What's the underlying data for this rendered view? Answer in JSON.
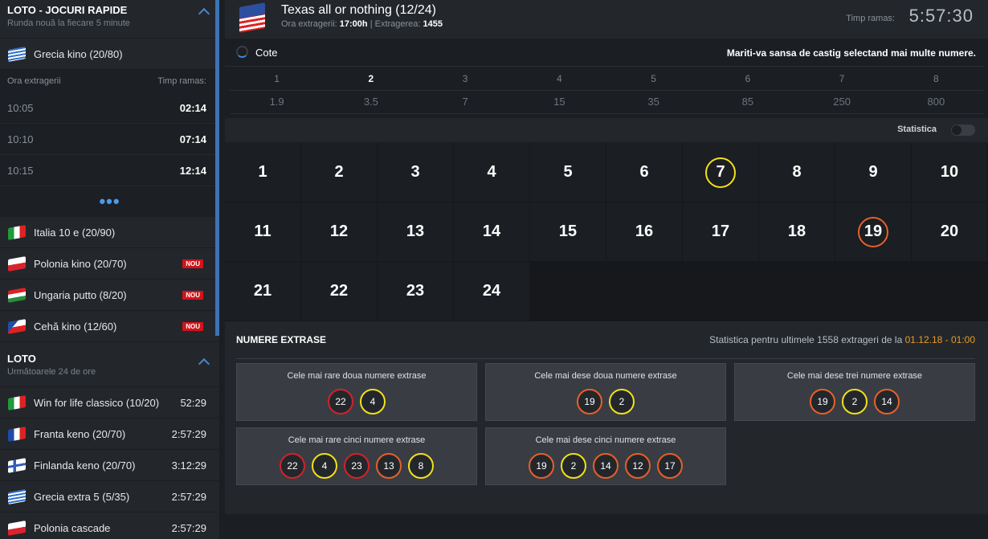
{
  "sidebar": {
    "quick": {
      "title": "LOTO - JOCURI RAPIDE",
      "subtitle": "Runda nouă la fiecare 5 minute",
      "selected_game": "Grecia kino (20/80)",
      "draw_header": {
        "left": "Ora extragerii",
        "right": "Timp ramas:"
      },
      "draws": [
        {
          "time": "10:05",
          "remaining": "02:14"
        },
        {
          "time": "10:10",
          "remaining": "07:14"
        },
        {
          "time": "10:15",
          "remaining": "12:14"
        }
      ],
      "more": "•••",
      "games": [
        {
          "name": "Italia 10 e (20/90)",
          "flag": "it",
          "badge": ""
        },
        {
          "name": "Polonia kino (20/70)",
          "flag": "pl",
          "badge": "NOU"
        },
        {
          "name": "Ungaria putto (8/20)",
          "flag": "hu",
          "badge": "NOU"
        },
        {
          "name": "Cehă kino (12/60)",
          "flag": "cz",
          "badge": "NOU"
        }
      ]
    },
    "loto": {
      "title": "LOTO",
      "subtitle": "Următoarele 24 de ore",
      "games": [
        {
          "name": "Win for life classico (10/20)",
          "flag": "it",
          "time": "52:29"
        },
        {
          "name": "Franta keno (20/70)",
          "flag": "fr",
          "time": "2:57:29"
        },
        {
          "name": "Finlanda keno (20/70)",
          "flag": "fi",
          "time": "3:12:29"
        },
        {
          "name": "Grecia extra 5 (5/35)",
          "flag": "gr",
          "time": "2:57:29"
        },
        {
          "name": "Polonia cascade",
          "flag": "pl",
          "time": "2:57:29"
        }
      ]
    }
  },
  "header": {
    "title": "Texas all or nothing (12/24)",
    "draw_time_label": "Ora extragerii:",
    "draw_time": "17:00h",
    "draw_no_label": "| Extragerea:",
    "draw_no": "1455",
    "remaining_label": "Timp ramas:",
    "remaining": "5:57:30",
    "flag_icon": "us-flag-icon"
  },
  "odds": {
    "label": "Cote",
    "hint": "Mariti-va sansa de castig selectand mai multe numere.",
    "keys": [
      "1",
      "2",
      "3",
      "4",
      "5",
      "6",
      "7",
      "8"
    ],
    "selected_key": "2",
    "values": [
      "1.9",
      "3.5",
      "7",
      "15",
      "35",
      "85",
      "250",
      "800"
    ]
  },
  "statistics_toggle": {
    "label": "Statistica",
    "on": false
  },
  "number_grid": {
    "numbers": [
      "1",
      "2",
      "3",
      "4",
      "5",
      "6",
      "7",
      "8",
      "9",
      "10",
      "11",
      "12",
      "13",
      "14",
      "15",
      "16",
      "17",
      "18",
      "19",
      "20",
      "21",
      "22",
      "23",
      "24"
    ],
    "highlight": {
      "7": "yellow",
      "19": "orange"
    }
  },
  "stats": {
    "title": "NUMERE EXTRASE",
    "info_prefix": "Statistica pentru ultimele 1558 extrageri de la",
    "info_date": "01.12.18 - 01:00",
    "boxes": [
      {
        "title": "Cele mai rare doua numere extrase",
        "balls": [
          {
            "n": "22",
            "c": "red"
          },
          {
            "n": "4",
            "c": "yel"
          }
        ]
      },
      {
        "title": "Cele mai dese doua numere extrase",
        "balls": [
          {
            "n": "19",
            "c": "org"
          },
          {
            "n": "2",
            "c": "yel"
          }
        ]
      },
      {
        "title": "Cele mai dese trei numere extrase",
        "balls": [
          {
            "n": "19",
            "c": "org"
          },
          {
            "n": "2",
            "c": "yel"
          },
          {
            "n": "14",
            "c": "org"
          }
        ]
      },
      {
        "title": "Cele mai rare cinci numere extrase",
        "balls": [
          {
            "n": "22",
            "c": "red"
          },
          {
            "n": "4",
            "c": "yel"
          },
          {
            "n": "23",
            "c": "red"
          },
          {
            "n": "13",
            "c": "org"
          },
          {
            "n": "8",
            "c": "yel"
          }
        ]
      },
      {
        "title": "Cele mai dese cinci numere extrase",
        "balls": [
          {
            "n": "19",
            "c": "org"
          },
          {
            "n": "2",
            "c": "yel"
          },
          {
            "n": "14",
            "c": "org"
          },
          {
            "n": "12",
            "c": "org"
          },
          {
            "n": "17",
            "c": "org"
          }
        ]
      }
    ]
  },
  "colors": {
    "accent": "#3a8ce0",
    "badge": "#d2141c",
    "yellow": "#f2e01a",
    "orange": "#e6602a",
    "red": "#d3222a",
    "date": "#e89a2a"
  }
}
